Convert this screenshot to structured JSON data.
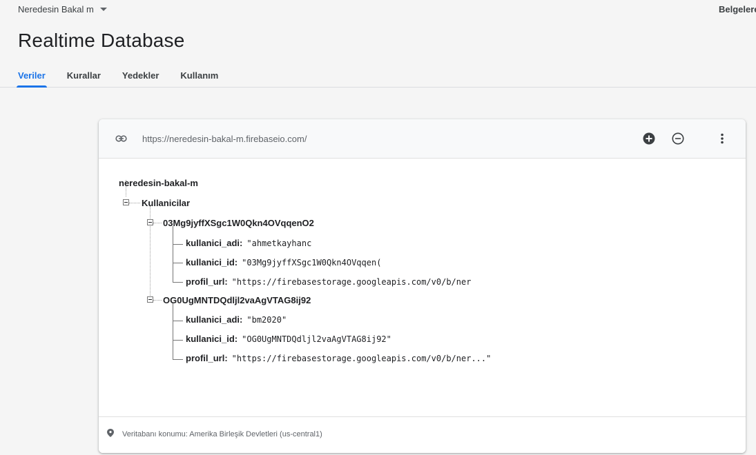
{
  "header": {
    "project_name": "Neredesin Bakal m",
    "docs_link": "Belgelere",
    "title": "Realtime Database",
    "tabs": [
      {
        "label": "Veriler",
        "active": true
      },
      {
        "label": "Kurallar",
        "active": false
      },
      {
        "label": "Yedekler",
        "active": false
      },
      {
        "label": "Kullanım",
        "active": false
      }
    ]
  },
  "toolbar": {
    "url": "https://neredesin-bakal-m.firebaseio.com/",
    "icons": [
      "link-icon",
      "add-circle-icon",
      "remove-circle-icon",
      "more-vert-icon"
    ]
  },
  "tree": {
    "root": "neredesin-bakal-m",
    "collection": "Kullanicilar",
    "records": [
      {
        "id": "03Mg9jyffXSgc1W0Qkn4OVqqenO2",
        "fields": [
          {
            "key": "kullanici_adi:",
            "value": "\"ahmetkayhanc"
          },
          {
            "key": "kullanici_id:",
            "value": "\"03Mg9jyffXSgc1W0Qkn4OVqqen("
          },
          {
            "key": "profil_url:",
            "value": "\"https://firebasestorage.googleapis.com/v0/b/ner"
          }
        ]
      },
      {
        "id": "OG0UgMNTDQdljl2vaAgVTAG8ij92",
        "fields": [
          {
            "key": "kullanici_adi:",
            "value": "\"bm2020\""
          },
          {
            "key": "kullanici_id:",
            "value": "\"OG0UgMNTDQdljl2vaAgVTAG8ij92\""
          },
          {
            "key": "profil_url:",
            "value": "\"https://firebasestorage.googleapis.com/v0/b/ner...\""
          }
        ]
      }
    ]
  },
  "footer": {
    "location": "Veritabanı konumu: Amerika Birleşik Devletleri (us-central1)",
    "icon": "location-pin-icon"
  },
  "colors": {
    "accent": "#1a73e8",
    "background": "#f5f5f5",
    "card": "#ffffff",
    "toolbar": "#f8f9fa"
  }
}
